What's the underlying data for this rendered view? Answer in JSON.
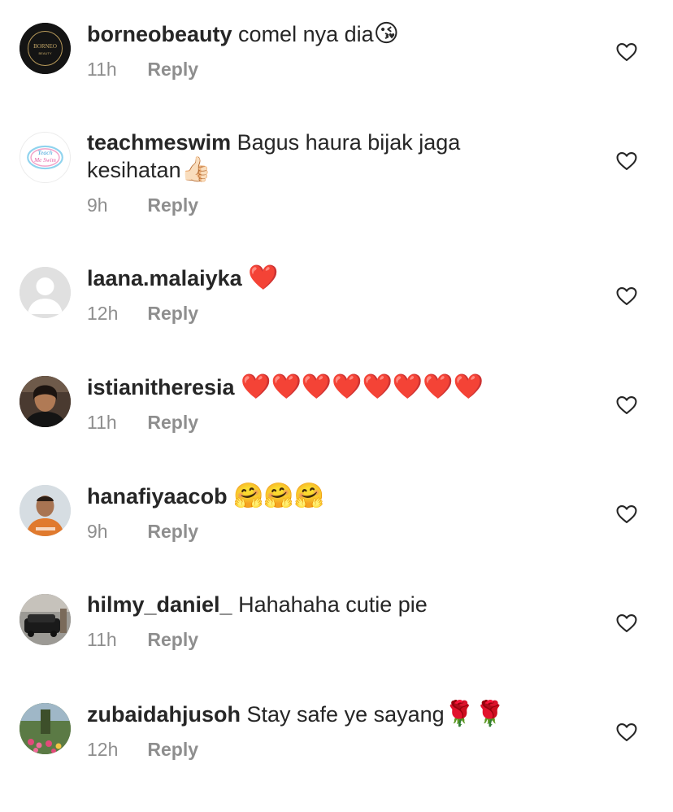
{
  "comments": [
    {
      "username": "borneobeauty",
      "text": "comel nya dia",
      "emoji": "😘",
      "time": "11h",
      "reply": "Reply"
    },
    {
      "username": "teachmeswim",
      "text": "Bagus haura bijak jaga",
      "text2": "kesihatan",
      "emoji": "👍🏻",
      "time": "9h",
      "reply": "Reply"
    },
    {
      "username": "laana.malaiyka",
      "text": "",
      "emoji": "❤️",
      "time": "12h",
      "reply": "Reply"
    },
    {
      "username": "istianitheresia",
      "text": "",
      "emoji": "❤️❤️❤️❤️❤️❤️❤️❤️",
      "time": "11h",
      "reply": "Reply"
    },
    {
      "username": "hanafiyaacob",
      "text": "",
      "emoji": "🤗🤗🤗",
      "time": "9h",
      "reply": "Reply"
    },
    {
      "username": "hilmy_daniel_",
      "text": "Hahahaha cutie pie",
      "emoji": "",
      "time": "11h",
      "reply": "Reply"
    },
    {
      "username": "zubaidahjusoh",
      "text": "Stay safe ye sayang",
      "emoji": "🌹🌹",
      "time": "12h",
      "reply": "Reply"
    }
  ],
  "avatars": {
    "borneo_line1": "BORNEO",
    "borneo_line2": "BEAUTY",
    "teachme_line1": "Teach",
    "teachme_line2": "Me Swim"
  },
  "icons": {
    "like": "heart-outline-icon"
  },
  "colors": {
    "text": "#262626",
    "meta": "#8e8e8e",
    "heart_stroke": "#262626"
  }
}
